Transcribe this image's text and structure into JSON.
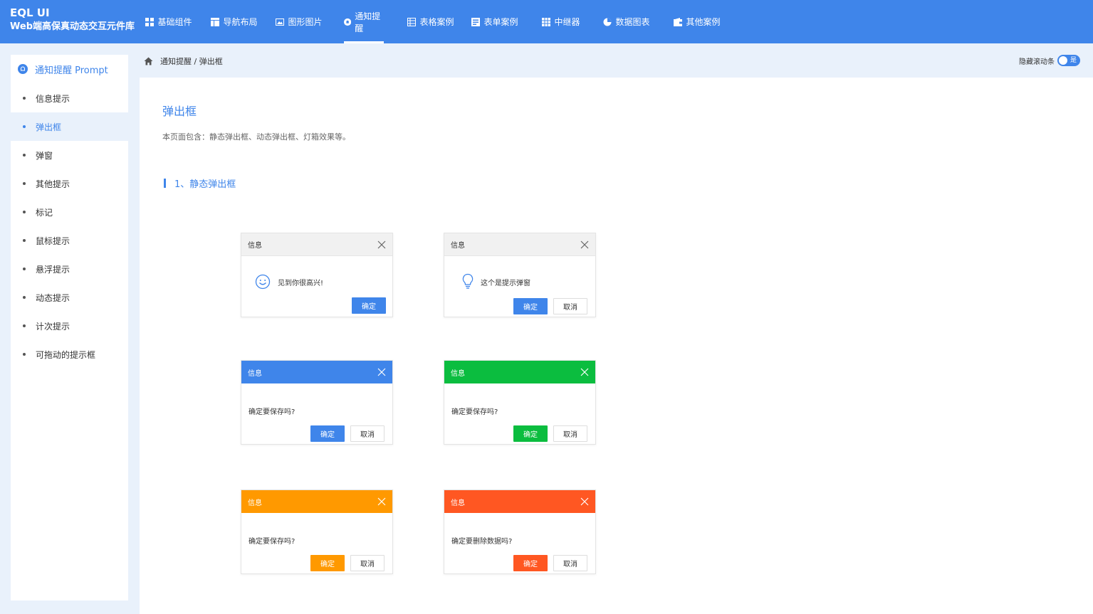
{
  "app": {
    "logo_line1": "EQL UI",
    "logo_line2": "Web端高保真动态交互元件库"
  },
  "nav": [
    {
      "label": "基础组件",
      "icon": "grid-icon"
    },
    {
      "label": "导航布局",
      "icon": "layout-icon"
    },
    {
      "label": "图形图片",
      "icon": "image-icon"
    },
    {
      "label": "通知提醒",
      "icon": "bell-icon",
      "active": true
    },
    {
      "label": "表格案例",
      "icon": "table-icon"
    },
    {
      "label": "表单案例",
      "icon": "form-icon"
    },
    {
      "label": "中继器",
      "icon": "repeater-icon"
    },
    {
      "label": "数据图表",
      "icon": "chart-icon"
    },
    {
      "label": "其他案例",
      "icon": "wallet-icon"
    }
  ],
  "sidebar": {
    "title": "通知提醒 Prompt",
    "items": [
      {
        "label": "信息提示"
      },
      {
        "label": "弹出框",
        "active": true
      },
      {
        "label": "弹窗"
      },
      {
        "label": "其他提示"
      },
      {
        "label": "标记"
      },
      {
        "label": "鼠标提示"
      },
      {
        "label": "悬浮提示"
      },
      {
        "label": "动态提示"
      },
      {
        "label": "计次提示"
      },
      {
        "label": "可拖动的提示框"
      }
    ]
  },
  "breadcrumb": {
    "text": "通知提醒 / 弹出框"
  },
  "scroll_toggle": {
    "label": "隐藏滚动条",
    "state": "是"
  },
  "main": {
    "title": "弹出框",
    "desc": "本页面包含：静态弹出框、动态弹出框、灯箱效果等。",
    "section1": "1、静态弹出框"
  },
  "dialogs": {
    "d1": {
      "title": "信息",
      "msg": "见到你很高兴!",
      "ok": "确定"
    },
    "d2": {
      "title": "信息",
      "msg": "这个是提示弹窗",
      "ok": "确定",
      "cancel": "取消"
    },
    "d3": {
      "title": "信息",
      "msg": "确定要保存吗?",
      "ok": "确定",
      "cancel": "取消",
      "color": "#3f85ea"
    },
    "d4": {
      "title": "信息",
      "msg": "确定要保存吗?",
      "ok": "确定",
      "cancel": "取消",
      "color": "#0bbd3f"
    },
    "d5": {
      "title": "信息",
      "msg": "确定要保存吗?",
      "ok": "确定",
      "cancel": "取消",
      "color": "#ff9900"
    },
    "d6": {
      "title": "信息",
      "msg": "确定要删除数据吗?",
      "ok": "确定",
      "cancel": "取消",
      "color": "#ff5722"
    }
  },
  "colors": {
    "accent": "#3f85ea",
    "green": "#0bbd3f",
    "orange": "#ff9900",
    "red": "#ff5722"
  }
}
